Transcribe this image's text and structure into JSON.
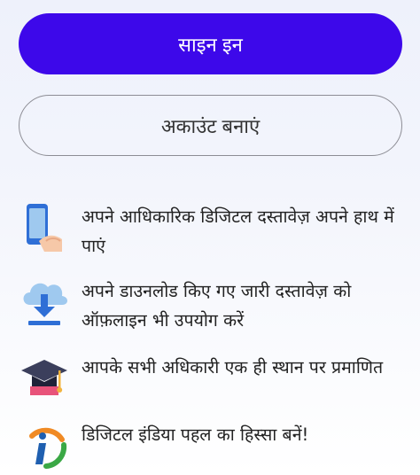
{
  "actions": {
    "sign_in_label": "साइन इन",
    "create_account_label": "अकाउंट बनाएं"
  },
  "features": [
    {
      "icon": "phone-hand-icon",
      "text": "अपने आधिकारिक डिजिटल दस्तावेज़ अपने हाथ में पाएं"
    },
    {
      "icon": "cloud-download-icon",
      "text": "अपने डाउनलोड किए गए जारी दस्तावेज़ को ऑफ़लाइन भी उपयोग करें"
    },
    {
      "icon": "graduation-cap-icon",
      "text": "आपके सभी अधिकारी एक ही स्थान पर प्रमाणित"
    },
    {
      "icon": "digital-india-logo-icon",
      "text": "डिजिटल इंडिया पहल का हिस्सा बनें!"
    }
  ],
  "colors": {
    "primary": "#3d08ea",
    "outline": "#8d8d95",
    "icon_blue": "#2f6fd6",
    "icon_light": "#9fc9ef"
  }
}
